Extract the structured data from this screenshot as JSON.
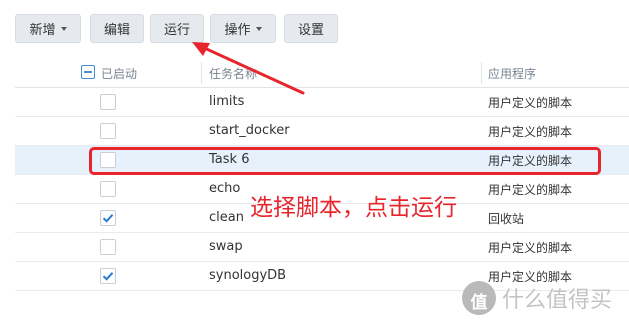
{
  "toolbar": {
    "new_label": "新增",
    "edit_label": "编辑",
    "run_label": "运行",
    "action_label": "操作",
    "settings_label": "设置"
  },
  "table": {
    "headers": {
      "enabled": "已启动",
      "task_name": "任务名称",
      "app": "应用程序"
    },
    "rows": [
      {
        "name": "limits",
        "app": "用户定义的脚本",
        "enabled": false
      },
      {
        "name": "start_docker",
        "app": "用户定义的脚本",
        "enabled": false
      },
      {
        "name": "Task 6",
        "app": "用户定义的脚本",
        "enabled": false,
        "selected": true
      },
      {
        "name": "echo",
        "app": "用户定义的脚本",
        "enabled": false
      },
      {
        "name": "clean",
        "app": "回收站",
        "enabled": true
      },
      {
        "name": "swap",
        "app": "用户定义的脚本",
        "enabled": false
      },
      {
        "name": "synologyDB",
        "app": "用户定义的脚本",
        "enabled": true
      }
    ]
  },
  "annotation": {
    "text": "选择脚本，点击运行",
    "color": "#e8252c"
  },
  "watermark": {
    "logo": "值",
    "text": "什么值得买"
  }
}
